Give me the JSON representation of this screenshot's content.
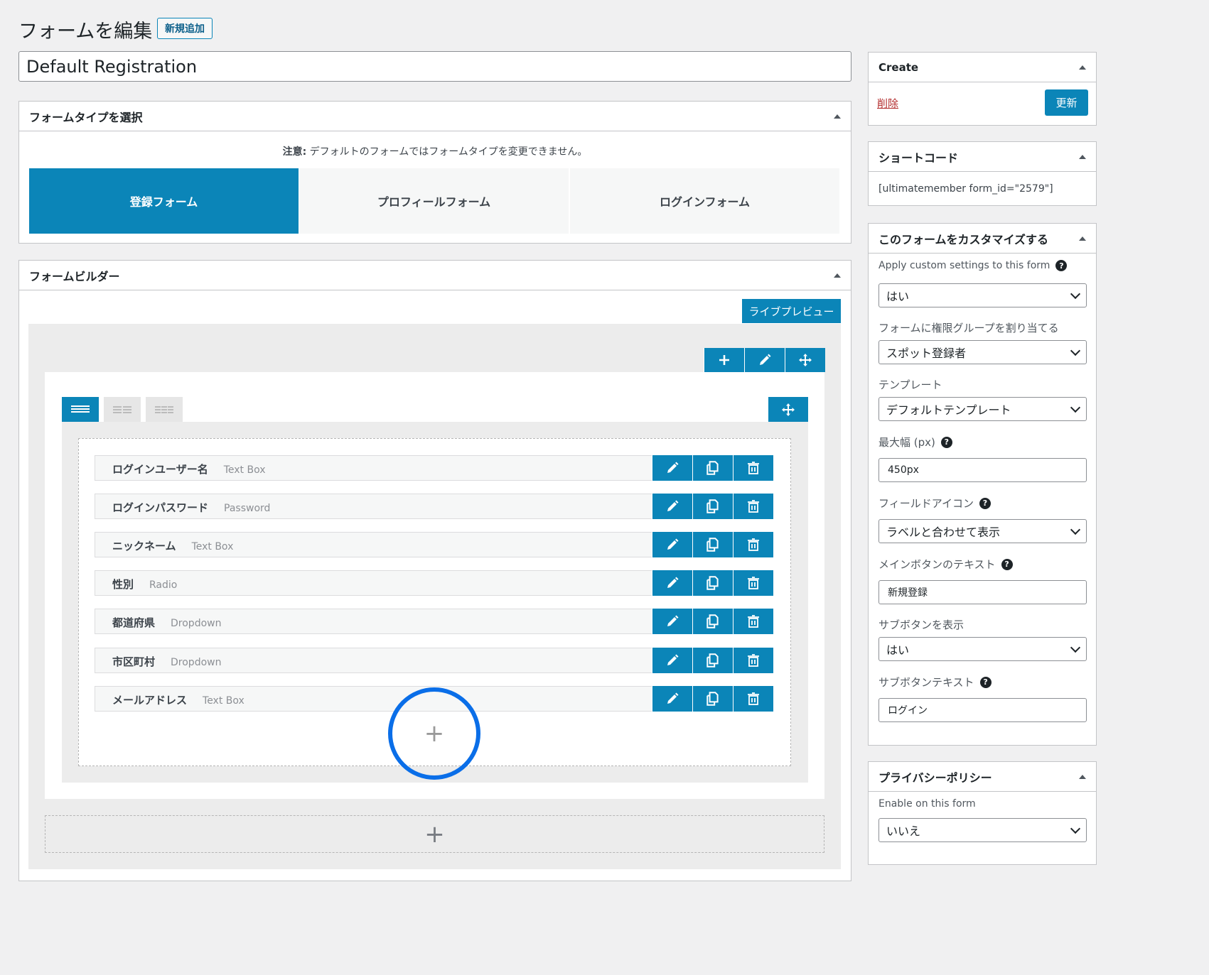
{
  "page": {
    "title": "フォームを編集",
    "add_new": "新規追加",
    "form_title_value": "Default Registration"
  },
  "form_type": {
    "header": "フォームタイプを選択",
    "notice_strong": "注意:",
    "notice_text": " デフォルトのフォームではフォームタイプを変更できません。",
    "tabs": [
      {
        "label": "登録フォーム",
        "active": true
      },
      {
        "label": "プロフィールフォーム",
        "active": false
      },
      {
        "label": "ログインフォーム",
        "active": false
      }
    ]
  },
  "builder": {
    "header": "フォームビルダー",
    "live_preview": "ライブプレビュー",
    "add_icon": "+",
    "fields": [
      {
        "label": "ログインユーザー名",
        "type": "Text Box"
      },
      {
        "label": "ログインパスワード",
        "type": "Password"
      },
      {
        "label": "ニックネーム",
        "type": "Text Box"
      },
      {
        "label": "性別",
        "type": "Radio"
      },
      {
        "label": "都道府県",
        "type": "Dropdown"
      },
      {
        "label": "市区町村",
        "type": "Dropdown"
      },
      {
        "label": "メールアドレス",
        "type": "Text Box"
      }
    ]
  },
  "create_box": {
    "header": "Create",
    "delete": "削除",
    "update": "更新"
  },
  "shortcode_box": {
    "header": "ショートコード",
    "value": "[ultimatemember form_id=\"2579\"]"
  },
  "customize_box": {
    "header": "このフォームをカスタマイズする",
    "apply_label": "Apply custom settings to this form",
    "apply_value": "はい",
    "role_label": "フォームに権限グループを割り当てる",
    "role_value": "スポット登録者",
    "template_label": "テンプレート",
    "template_value": "デフォルトテンプレート",
    "max_width_label": "最大幅 (px)",
    "max_width_value": "450px",
    "field_icon_label": "フィールドアイコン",
    "field_icon_value": "ラベルと合わせて表示",
    "main_button_label": "メインボタンのテキスト",
    "main_button_value": "新規登録",
    "sub_button_show_label": "サブボタンを表示",
    "sub_button_show_value": "はい",
    "sub_button_text_label": "サブボタンテキスト",
    "sub_button_text_value": "ログイン"
  },
  "privacy_box": {
    "header": "プライバシーポリシー",
    "enable_label": "Enable on this form",
    "enable_value": "いいえ"
  },
  "colors": {
    "accent": "#0b85b8",
    "highlight_ring": "#0a6ee8",
    "delete_link": "#b32d2e"
  },
  "icons": [
    "plus-icon",
    "pencil-icon",
    "move-icon",
    "copy-icon",
    "trash-icon",
    "help-icon",
    "chevron-down-icon",
    "collapse-triangle-icon"
  ]
}
